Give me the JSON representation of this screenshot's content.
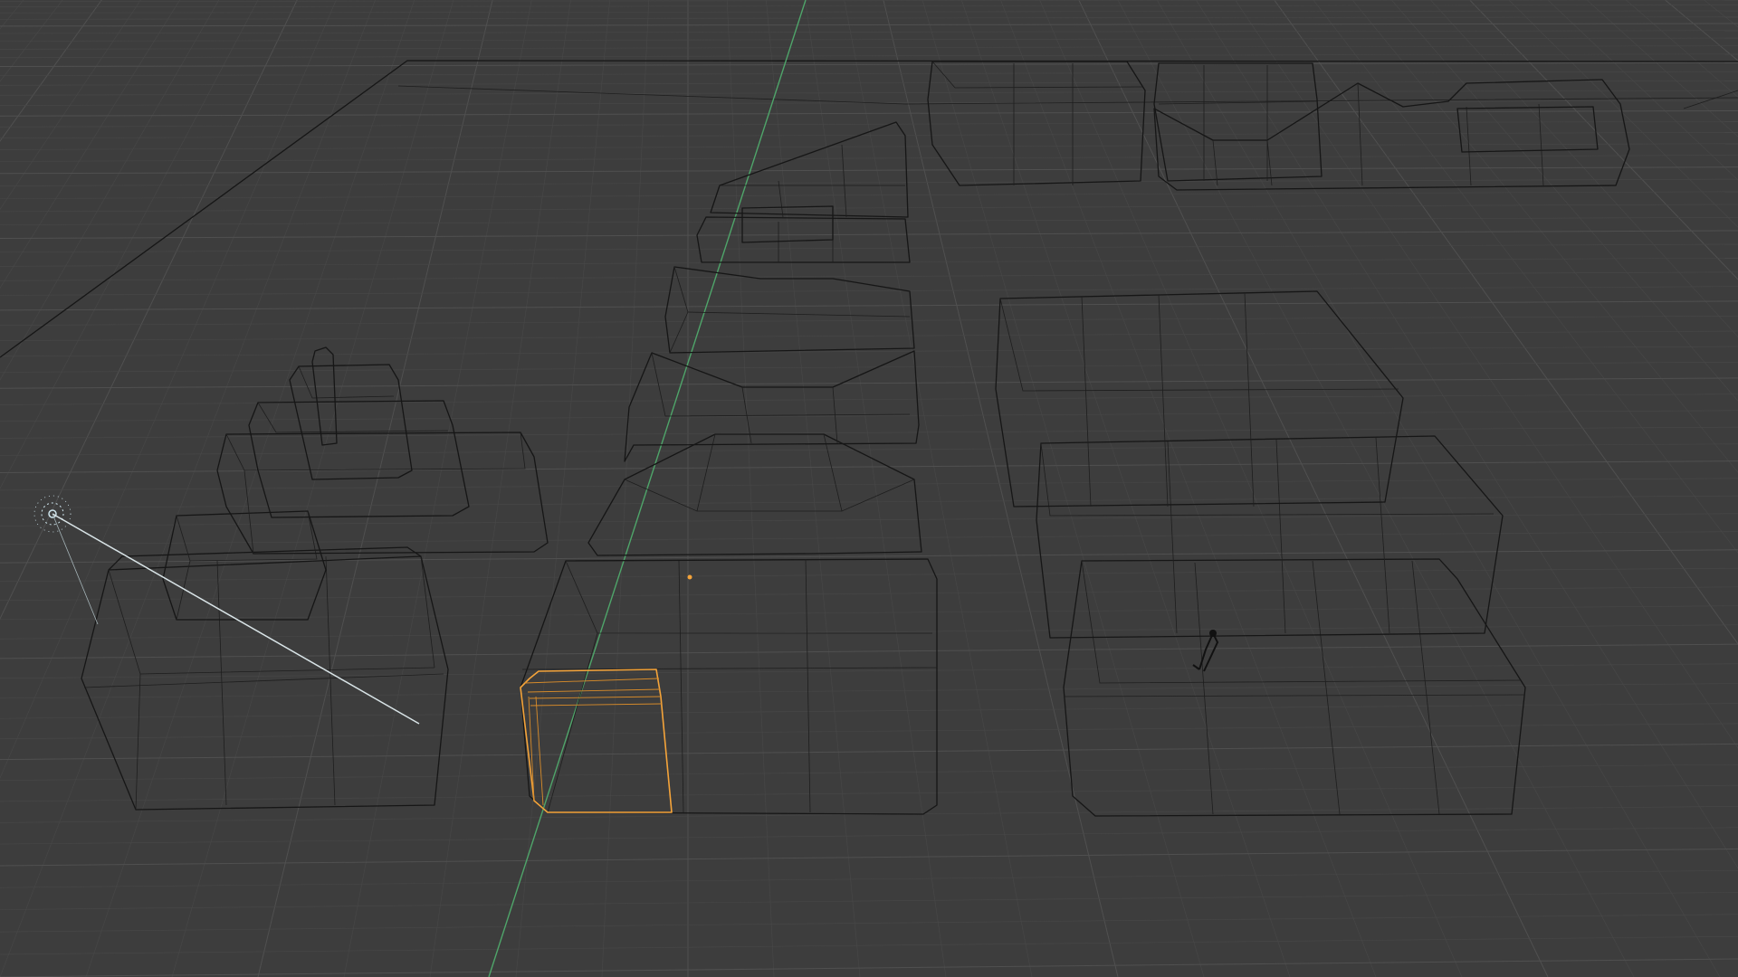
{
  "app": {
    "name": "3D Viewport",
    "shading": "wireframe",
    "background_color": "#3d3d3d"
  },
  "grid": {
    "minor_line_color": "#474747",
    "major_line_color": "#505050",
    "y_axis_color": "#4fa56a"
  },
  "selection": {
    "selected_object_outline_color": "#f5a43a",
    "origin_dot_color": "#f5a43a"
  },
  "objects": [
    {
      "name": "light",
      "icon": "sun-light-icon"
    },
    {
      "name": "armature",
      "icon": "character-rig-icon"
    }
  ]
}
